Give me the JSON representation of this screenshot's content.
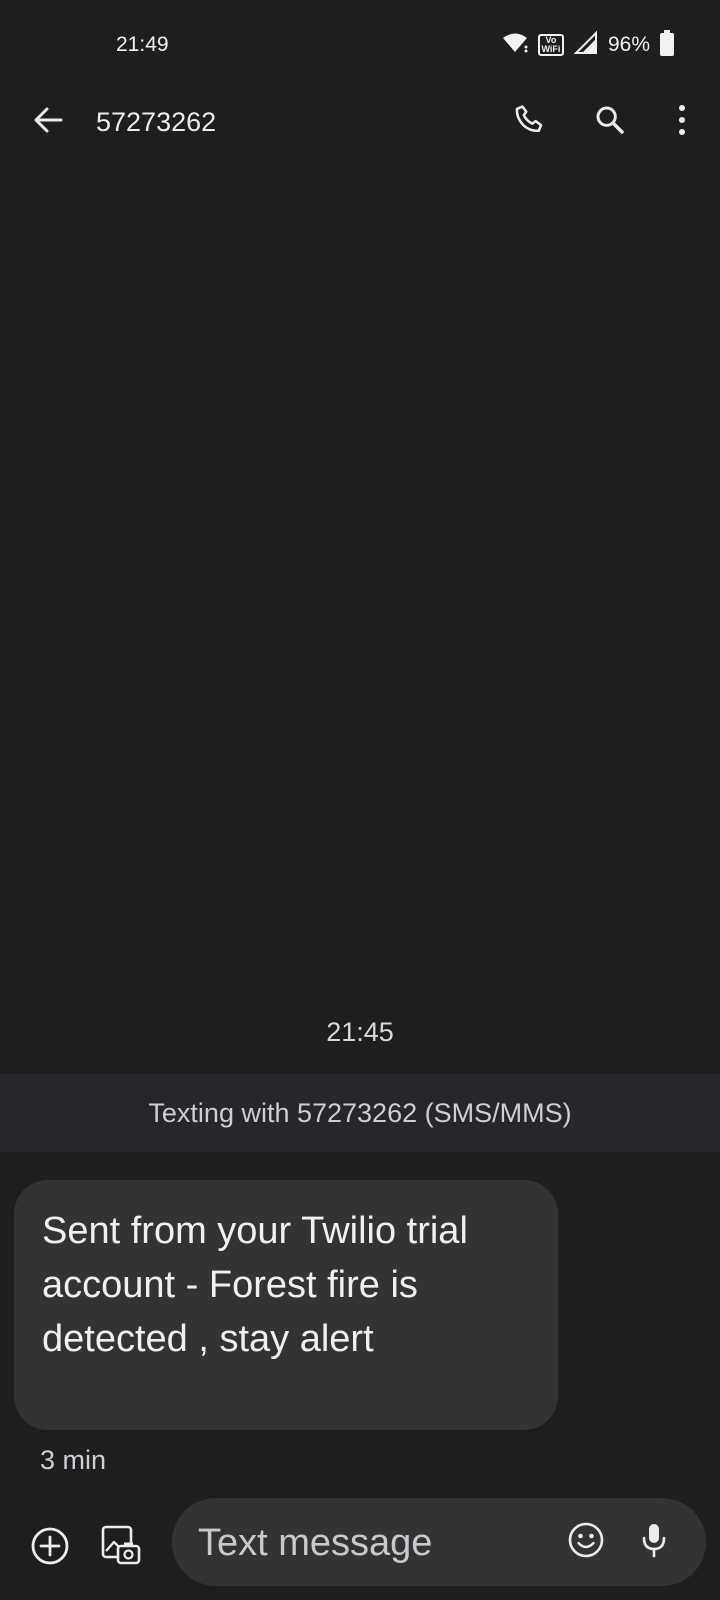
{
  "status_bar": {
    "time": "21:49",
    "vowifi_line1": "Vo",
    "vowifi_line2": "WiFi",
    "battery": "96%"
  },
  "app_bar": {
    "contact": "57273262",
    "icons": [
      "back-arrow-icon",
      "phone-icon",
      "search-icon",
      "more-vert-icon"
    ]
  },
  "conversation": {
    "timestamp": "21:45",
    "banner": "Texting with 57273262 (SMS/MMS)",
    "messages": [
      {
        "text": "Sent from your Twilio trial account - Forest fire is detected , stay alert",
        "age": "3 min"
      }
    ]
  },
  "compose": {
    "placeholder": "Text message",
    "icons": [
      "add-circle-icon",
      "gallery-icon",
      "emoji-icon",
      "mic-icon"
    ]
  },
  "colors": {
    "background": "#1e1e20",
    "bubble": "#333336",
    "banner": "#26262b"
  }
}
